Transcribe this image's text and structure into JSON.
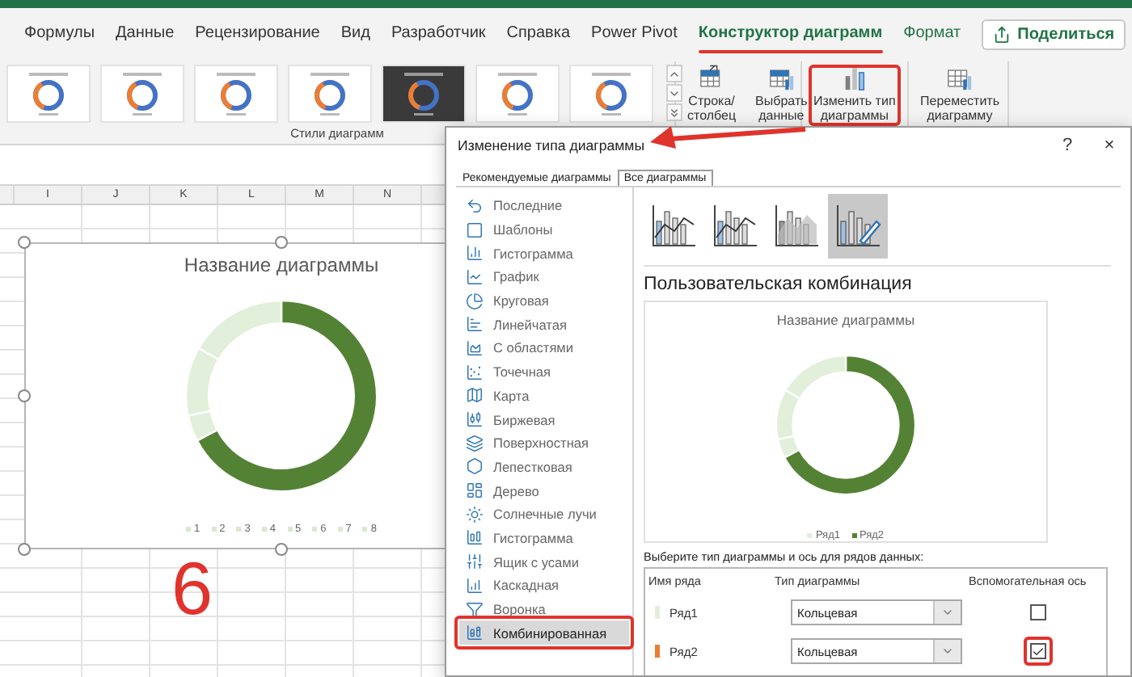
{
  "ribbon": {
    "tabs": [
      {
        "label": "Формулы",
        "selected": false,
        "contextual": false,
        "annotated": false
      },
      {
        "label": "Данные",
        "selected": false,
        "contextual": false,
        "annotated": false
      },
      {
        "label": "Рецензирование",
        "selected": false,
        "contextual": false,
        "annotated": false
      },
      {
        "label": "Вид",
        "selected": false,
        "contextual": false,
        "annotated": false
      },
      {
        "label": "Разработчик",
        "selected": false,
        "contextual": false,
        "annotated": false
      },
      {
        "label": "Справка",
        "selected": false,
        "contextual": false,
        "annotated": false
      },
      {
        "label": "Power Pivot",
        "selected": false,
        "contextual": false,
        "annotated": false
      },
      {
        "label": "Конструктор диаграмм",
        "selected": true,
        "contextual": true,
        "annotated": true
      },
      {
        "label": "Формат",
        "selected": false,
        "contextual": true,
        "annotated": false
      }
    ],
    "share_button": "Поделиться",
    "style_gallery": {
      "label": "Стили диаграмм",
      "thumbnails": [
        {
          "dark": false
        },
        {
          "dark": false
        },
        {
          "dark": false
        },
        {
          "dark": false
        },
        {
          "dark": true
        },
        {
          "dark": false
        },
        {
          "dark": false
        }
      ]
    },
    "buttons": [
      {
        "kind": "swap",
        "label": "Строка/\nстолбец",
        "annotated": false
      },
      {
        "kind": "select",
        "label": "Выбрать\nданные",
        "annotated": false
      },
      {
        "kind": "change",
        "label": "Изменить тип\nдиаграммы",
        "annotated": true
      },
      {
        "kind": "move",
        "label": "Переместить\nдиаграмму",
        "annotated": false
      }
    ]
  },
  "sheet": {
    "columns": [
      "I",
      "J",
      "K",
      "L",
      "M",
      "N"
    ],
    "chart": {
      "title": "Название диаграммы",
      "legend": [
        "1",
        "2",
        "3",
        "4",
        "5",
        "6",
        "7",
        "8"
      ]
    },
    "step_number": "6"
  },
  "dialog": {
    "title": "Изменение типа диаграммы",
    "help": "?",
    "close": "×",
    "tabs": [
      {
        "label": "Рекомендуемые диаграммы",
        "selected": false
      },
      {
        "label": "Все диаграммы",
        "selected": true
      }
    ],
    "chart_types": [
      {
        "label": "Последние",
        "selected": false,
        "annotated": false
      },
      {
        "label": "Шаблоны",
        "selected": false,
        "annotated": false
      },
      {
        "label": "Гистограмма",
        "selected": false,
        "annotated": false
      },
      {
        "label": "График",
        "selected": false,
        "annotated": false
      },
      {
        "label": "Круговая",
        "selected": false,
        "annotated": false
      },
      {
        "label": "Линейчатая",
        "selected": false,
        "annotated": false
      },
      {
        "label": "С областями",
        "selected": false,
        "annotated": false
      },
      {
        "label": "Точечная",
        "selected": false,
        "annotated": false
      },
      {
        "label": "Карта",
        "selected": false,
        "annotated": false
      },
      {
        "label": "Биржевая",
        "selected": false,
        "annotated": false
      },
      {
        "label": "Поверхностная",
        "selected": false,
        "annotated": false
      },
      {
        "label": "Лепестковая",
        "selected": false,
        "annotated": false
      },
      {
        "label": "Дерево",
        "selected": false,
        "annotated": false
      },
      {
        "label": "Солнечные лучи",
        "selected": false,
        "annotated": false
      },
      {
        "label": "Гистограмма",
        "selected": false,
        "annotated": false
      },
      {
        "label": "Ящик с усами",
        "selected": false,
        "annotated": false
      },
      {
        "label": "Каскадная",
        "selected": false,
        "annotated": false
      },
      {
        "label": "Воронка",
        "selected": false,
        "annotated": false
      },
      {
        "label": "Комбинированная",
        "selected": true,
        "annotated": true
      }
    ],
    "subtypes": [
      {
        "selected": false
      },
      {
        "selected": false
      },
      {
        "selected": false
      },
      {
        "selected": true
      }
    ],
    "subtype_title": "Пользовательская комбинация",
    "preview": {
      "title": "Название диаграммы",
      "legend": [
        {
          "label": "Ряд1",
          "color": "#e2efda"
        },
        {
          "label": "Ряд2",
          "color": "#548235"
        }
      ]
    },
    "series_prompt": "Выберите тип диаграммы и ось для рядов данных:",
    "series_table": {
      "columns": [
        "Имя ряда",
        "Тип диаграммы",
        "Вспомогательная ось"
      ],
      "rows": [
        {
          "name": "Ряд1",
          "color": "#e2efda",
          "chart_type": "Кольцевая",
          "secondary_axis": false,
          "annotated": false
        },
        {
          "name": "Ряд2",
          "color": "#ed7d31",
          "chart_type": "Кольцевая",
          "secondary_axis": true,
          "annotated": true
        }
      ]
    }
  }
}
